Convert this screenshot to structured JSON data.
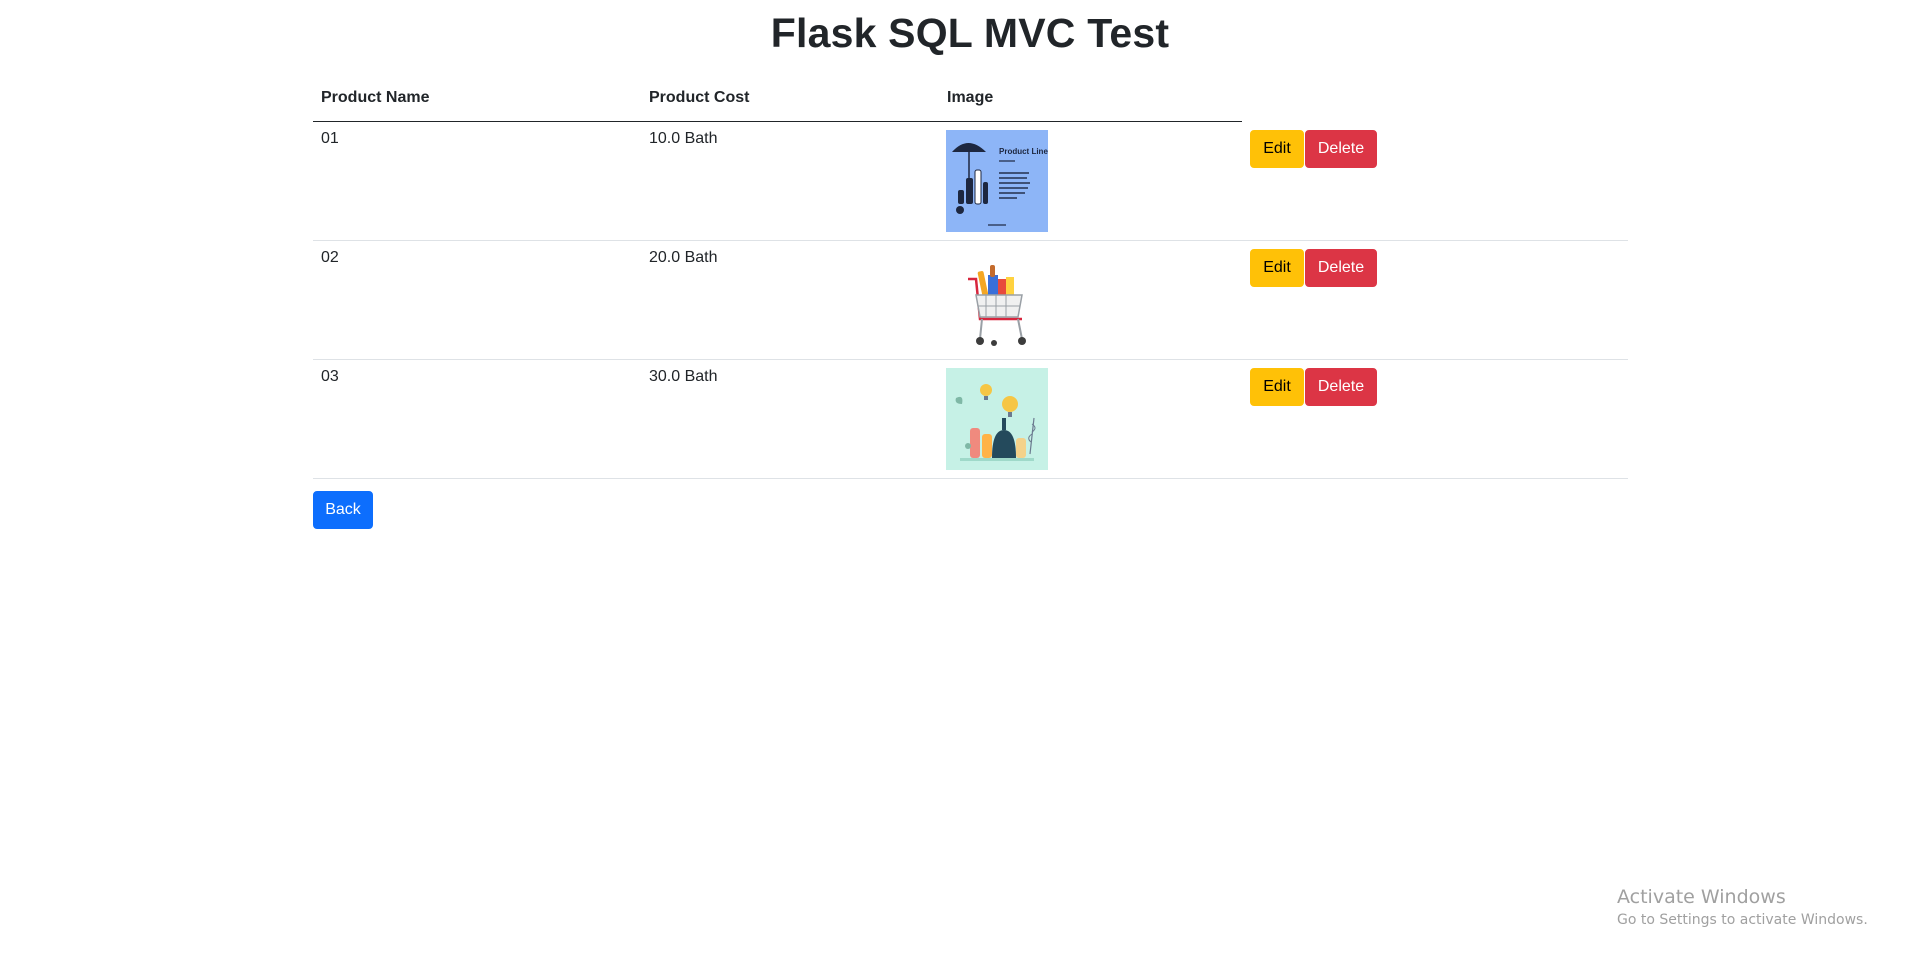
{
  "page": {
    "title": "Flask SQL MVC Test"
  },
  "table": {
    "headers": [
      "Product Name",
      "Product Cost",
      "Image"
    ],
    "rows": [
      {
        "name": "01",
        "cost": "10.0 Bath",
        "image": "product-line-image"
      },
      {
        "name": "02",
        "cost": "20.0 Bath",
        "image": "shopping-cart-image"
      },
      {
        "name": "03",
        "cost": "30.0 Bath",
        "image": "cosmetics-products-image"
      }
    ],
    "actions": {
      "edit_label": "Edit",
      "delete_label": "Delete"
    }
  },
  "back_label": "Back",
  "watermark": {
    "title": "Activate Windows",
    "subtitle": "Go to Settings to activate Windows."
  },
  "image_texts": {
    "product_line_heading": "Product Line"
  },
  "colors": {
    "edit": "#ffc107",
    "delete": "#dc3545",
    "back": "#0d6efd",
    "text": "#212529"
  }
}
